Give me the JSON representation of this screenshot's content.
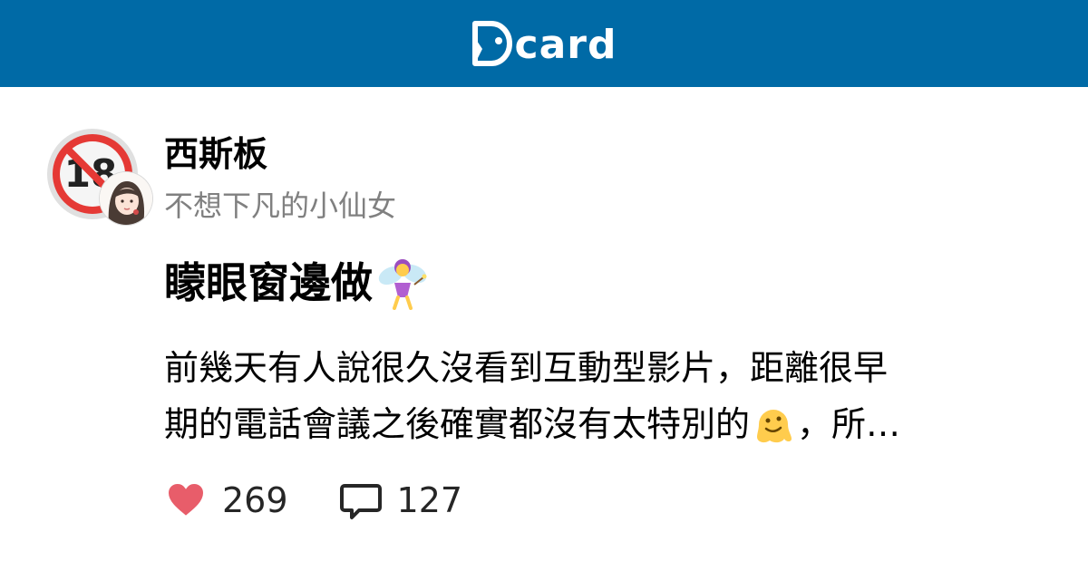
{
  "header": {
    "logo_text": "card",
    "logo_icon": "dcard-logo-icon",
    "background_color": "#006aa6"
  },
  "post": {
    "forum_badge_icon": "age-18-restricted-icon",
    "avatar_icon": "user-avatar-illustration",
    "forum_name": "西斯板",
    "author_name": "不想下凡的小仙女",
    "title": "矇眼窗邊做",
    "title_emoji": "fairy-emoji",
    "excerpt_line1": "前幾天有人說很久沒看到互動型影片，距離很早",
    "excerpt_line2_part1": "期的電話會議之後確實都沒有太特別的",
    "excerpt_emoji": "melting-face-emoji",
    "excerpt_line2_part2": "，所…"
  },
  "stats": {
    "like_icon": "heart-icon",
    "likes": "269",
    "comment_icon": "comment-bubble-icon",
    "comments": "127",
    "like_color": "#e85d6a"
  }
}
